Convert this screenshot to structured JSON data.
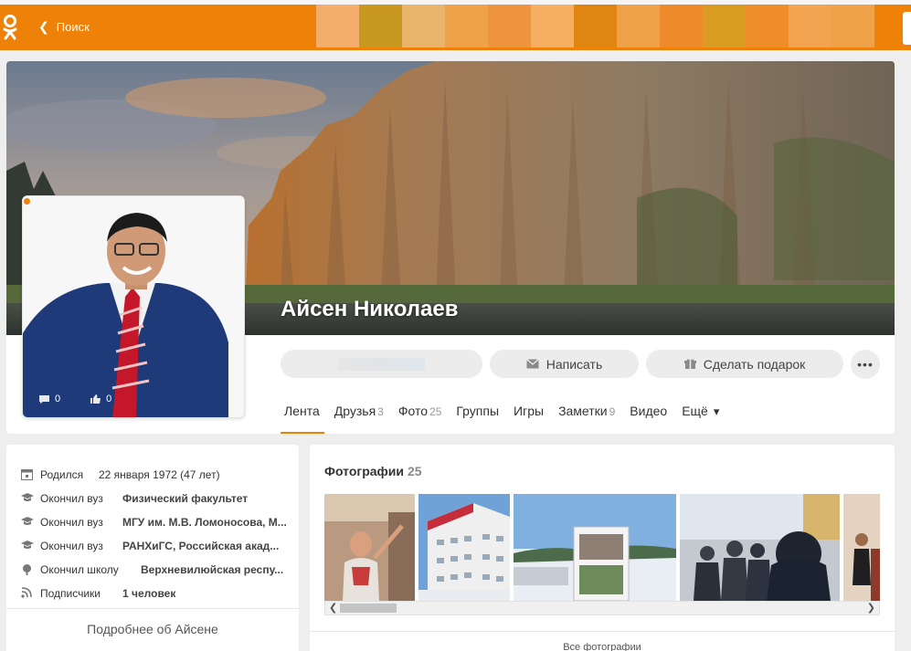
{
  "header": {
    "back_label": "Поиск",
    "logo_icon": "odnoklassniki-logo-icon",
    "accent_color": "#ee8208",
    "mosaic_colors": [
      "#f5ad6b",
      "#c9981f",
      "#e8b56a",
      "#f0a24b",
      "#ee9440",
      "#f5ae62",
      "#e0850f",
      "#f0a24b",
      "#ee8a2a",
      "#d99b22",
      "#ef8d2a",
      "#f3a450",
      "#f0a24b"
    ]
  },
  "profile": {
    "name": "Айсен Николаев",
    "avatar_stats": {
      "comments": "0",
      "likes": "0"
    },
    "buttons": {
      "write": "Написать",
      "gift": "Сделать подарок",
      "more": "•••"
    },
    "tabs": [
      {
        "label": "Лента",
        "count": ""
      },
      {
        "label": "Друзья",
        "count": "3"
      },
      {
        "label": "Фото",
        "count": "25"
      },
      {
        "label": "Группы",
        "count": ""
      },
      {
        "label": "Игры",
        "count": ""
      },
      {
        "label": "Заметки",
        "count": "9"
      },
      {
        "label": "Видео",
        "count": ""
      },
      {
        "label": "Ещё",
        "count": ""
      }
    ]
  },
  "info": {
    "rows": [
      {
        "icon": "calendar-icon",
        "label": "Родился",
        "value": "22 января 1972 (47 лет)"
      },
      {
        "icon": "graduation-cap-icon",
        "label": "Окончил вуз",
        "value": "Физический факультет"
      },
      {
        "icon": "graduation-cap-icon",
        "label": "Окончил вуз",
        "value": "МГУ им. М.В. Ломоносова, М..."
      },
      {
        "icon": "graduation-cap-icon",
        "label": "Окончил вуз",
        "value": "РАНХиГС, Российская акад..."
      },
      {
        "icon": "school-icon",
        "label": "Окончил школу",
        "value": "Верхневилюйская респу..."
      },
      {
        "icon": "rss-icon",
        "label": "Подписчики",
        "value": "1 человек"
      }
    ],
    "more_about": "Подробнее об Айсене"
  },
  "photos": {
    "title": "Фотографии",
    "count": "25",
    "all_photos": "Все фотографии"
  }
}
